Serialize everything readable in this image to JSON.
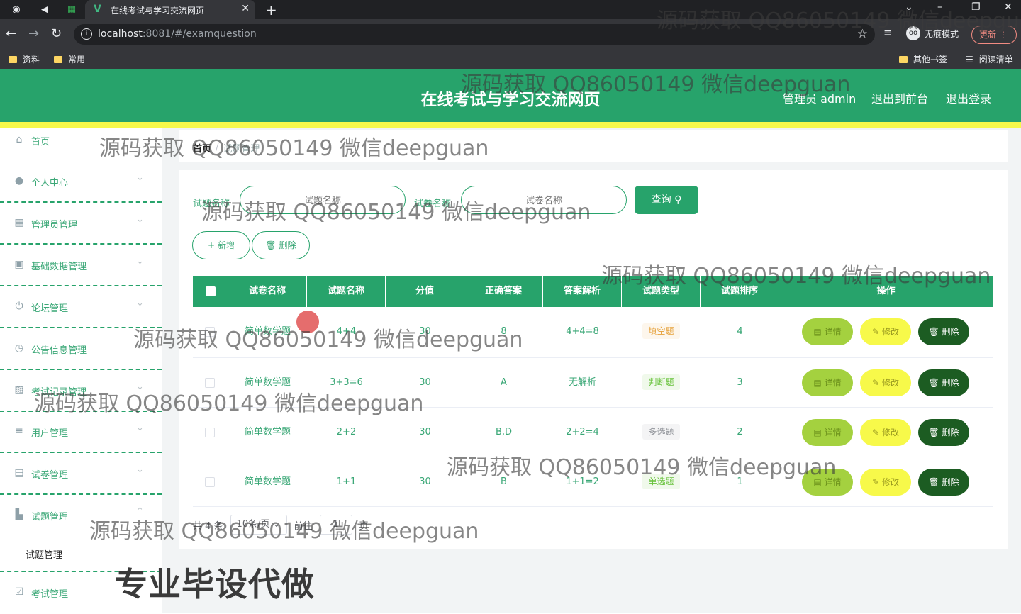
{
  "browser": {
    "tab_title": "在线考试与学习交流网页",
    "url_host": "localhost",
    "url_rest": ":8081/#/examquestion",
    "incognito_label": "无痕模式",
    "update_label": "更新",
    "bookmarks": [
      "资料",
      "常用"
    ],
    "bookmarks_right": [
      "其他书签",
      "阅读清单"
    ]
  },
  "header": {
    "title": "在线考试与学习交流网页",
    "admin": "管理员 admin",
    "back_front": "退出到前台",
    "logout": "退出登录",
    "colors": {
      "primary": "#27a36b",
      "accent_bar": "#f7f94a"
    }
  },
  "sidebar": {
    "items": [
      {
        "label": "首页",
        "icon": "home-icon"
      },
      {
        "label": "个人中心",
        "icon": "user-icon"
      },
      {
        "label": "管理员管理",
        "icon": "grid-icon"
      },
      {
        "label": "基础数据管理",
        "icon": "calendar-icon"
      },
      {
        "label": "论坛管理",
        "icon": "power-icon"
      },
      {
        "label": "公告信息管理",
        "icon": "clock-icon"
      },
      {
        "label": "考试记录管理",
        "icon": "chart-icon"
      },
      {
        "label": "用户管理",
        "icon": "list-icon"
      },
      {
        "label": "试卷管理",
        "icon": "chat-icon"
      },
      {
        "label": "试题管理",
        "icon": "building-icon"
      },
      {
        "label": "考试管理",
        "icon": "checkbox-icon"
      }
    ],
    "sub_item": "试题管理"
  },
  "breadcrumb": {
    "home": "首页",
    "current": "试题管理"
  },
  "filters": {
    "label1": "试题名称",
    "placeholder1": "试题名称",
    "label2": "试卷名称",
    "placeholder2": "试卷名称",
    "query_button": "查询"
  },
  "actions": {
    "add": "新增",
    "delete": "删除"
  },
  "table": {
    "headers": [
      "试卷名称",
      "试题名称",
      "分值",
      "正确答案",
      "答案解析",
      "试题类型",
      "试题排序",
      "操作"
    ],
    "rows": [
      {
        "paper": "简单数学题",
        "name": "4+4",
        "score": "30",
        "answer": "8",
        "analysis": "4+4=8",
        "type": "填空题",
        "order": "4"
      },
      {
        "paper": "简单数学题",
        "name": "3+3=6",
        "score": "30",
        "answer": "A",
        "analysis": "无解析",
        "type": "判断题",
        "order": "3"
      },
      {
        "paper": "简单数学题",
        "name": "2+2",
        "score": "30",
        "answer": "B,D",
        "analysis": "2+2=4",
        "type": "多选题",
        "order": "2"
      },
      {
        "paper": "简单数学题",
        "name": "1+1",
        "score": "30",
        "answer": "B",
        "analysis": "1+1=2",
        "type": "单选题",
        "order": "1"
      }
    ],
    "op_detail": "详情",
    "op_edit": "修改",
    "op_delete": "删除"
  },
  "pager": {
    "total": "共 4 条",
    "page_size": "10条/页",
    "goto": "前往",
    "page_num": "1",
    "page_unit": "页"
  },
  "watermark": {
    "text": "源码获取 QQ86050149 微信deepguan",
    "big": "专业毕设代做"
  }
}
